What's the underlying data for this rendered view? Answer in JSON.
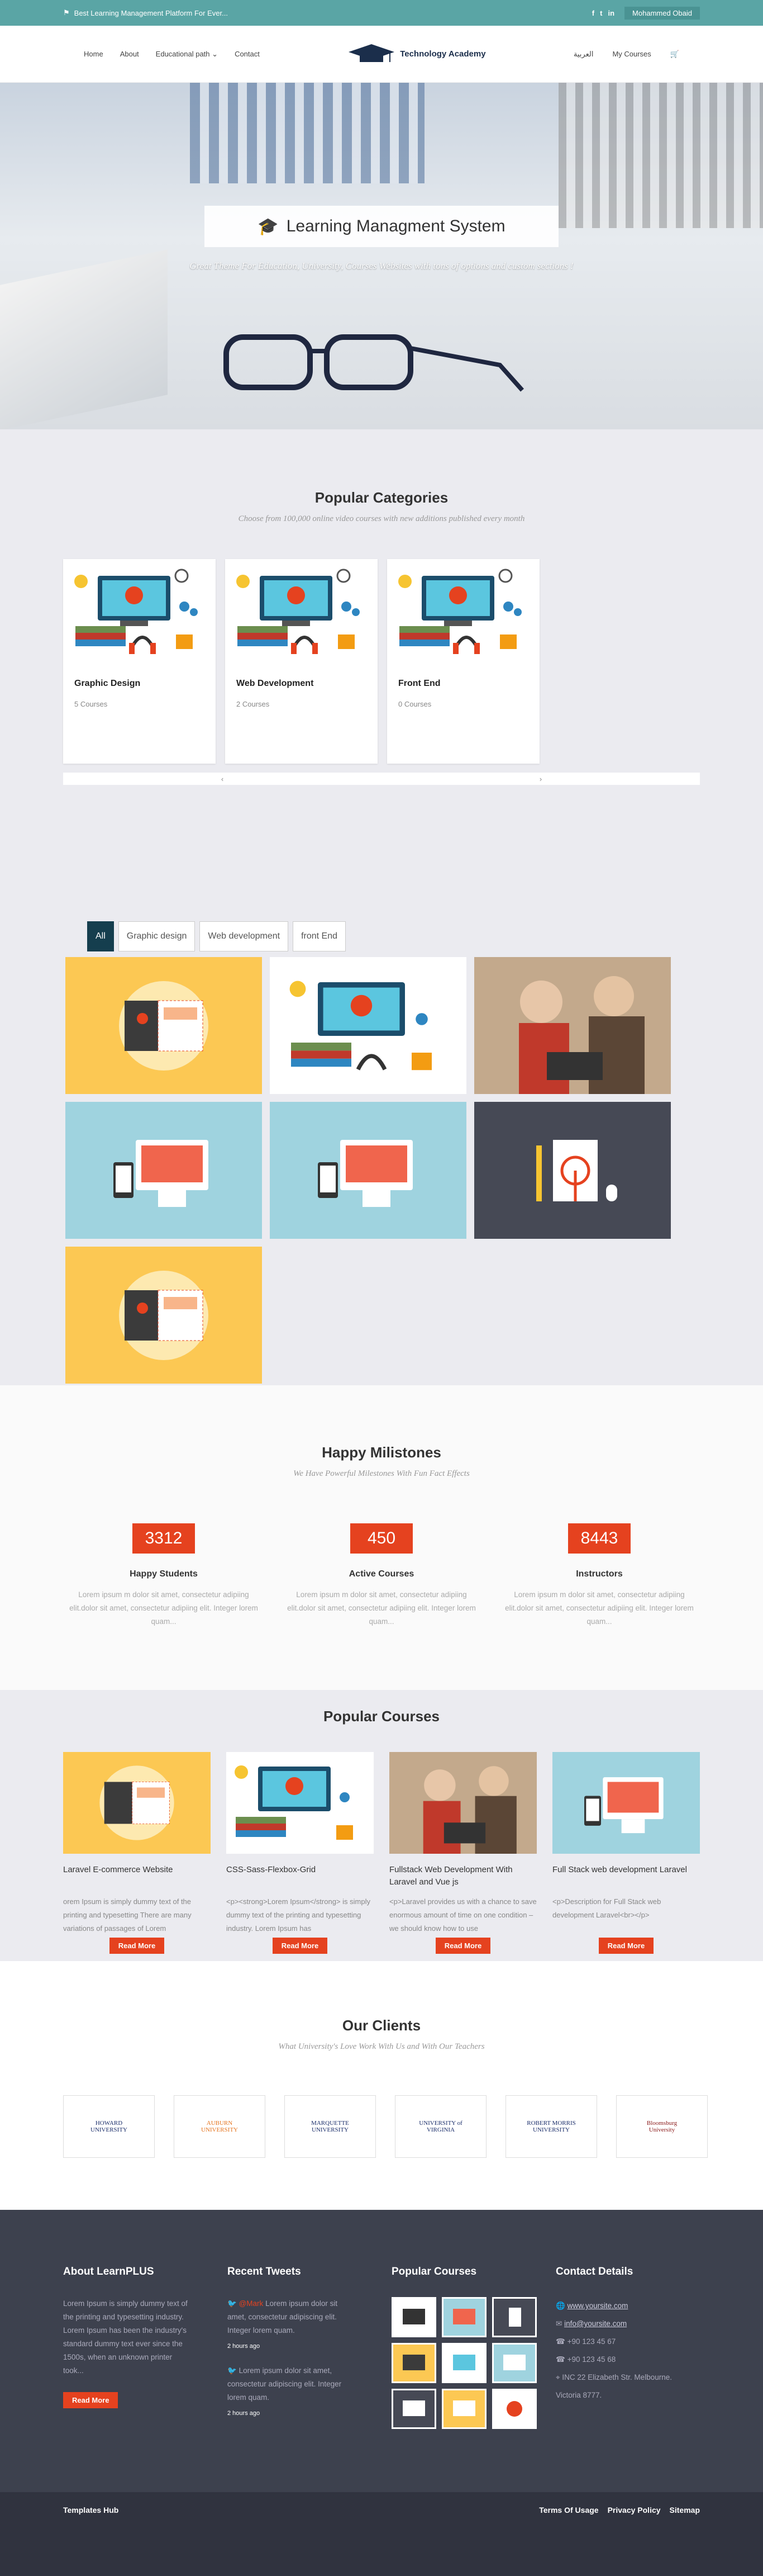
{
  "topbar": {
    "tagline": "Best Learning Management Platform For Ever...",
    "social_icons": [
      "facebook-icon",
      "twitter-icon",
      "linkedin-icon"
    ],
    "user_name": "Mohammed Obaid"
  },
  "nav": {
    "home": "Home",
    "about": "About",
    "educational_path": "Educational path",
    "contact": "Contact",
    "logo_text": "Technology Academy",
    "language": "العربية",
    "my_courses": "My Courses"
  },
  "hero": {
    "title": "Learning Managment System",
    "subtitle": "Great Theme For Education, University, Courses Websites with tons of options and custom sections !"
  },
  "categories": {
    "title": "Popular Categories",
    "subtitle": "Choose from 100,000 online video courses with new additions published every month",
    "items": [
      {
        "name": "Graphic Design",
        "count": "5 Courses"
      },
      {
        "name": "Web Development",
        "count": "2 Courses"
      },
      {
        "name": "Front End",
        "count": "0 Courses"
      }
    ],
    "prev": "‹",
    "next": "›"
  },
  "portfolio": {
    "filters": [
      "All",
      "Graphic design",
      "Web development",
      "front End"
    ]
  },
  "milestones": {
    "title": "Happy Milistones",
    "subtitle": "We Have Powerful Milestones With Fun Fact Effects",
    "items": [
      {
        "value": "3312",
        "label": "Happy Students",
        "desc": "Lorem ipsum m dolor sit amet, consectetur adipiing elit.dolor sit amet, consectetur adipiing elit. Integer lorem quam..."
      },
      {
        "value": "450",
        "label": "Active Courses",
        "desc": "Lorem ipsum m dolor sit amet, consectetur adipiing elit.dolor sit amet, consectetur adipiing elit. Integer lorem quam..."
      },
      {
        "value": "8443",
        "label": "Instructors",
        "desc": "Lorem ipsum m dolor sit amet, consectetur adipiing elit.dolor sit amet, consectetur adipiing elit. Integer lorem quam..."
      }
    ]
  },
  "popular_courses": {
    "title": "Popular Courses",
    "read_more": "Read More",
    "items": [
      {
        "title": "Laravel E-commerce Website",
        "desc": "orem Ipsum is simply dummy text of the printing and typesetting There are many variations of passages of Lorem"
      },
      {
        "title": "CSS-Sass-Flexbox-Grid",
        "desc": "<p><strong>Lorem Ipsum</strong> is simply dummy text of the printing and typesetting industry. Lorem Ipsum has"
      },
      {
        "title": "Fullstack Web Development With Laravel and Vue js",
        "desc": "<p>Laravel provides us with a chance to save enormous amount of time on one condition – we should know how to use"
      },
      {
        "title": "Full Stack web development Laravel",
        "desc": "<p>Description for Full Stack web development Laravel<br></p>"
      }
    ]
  },
  "clients": {
    "title": "Our Clients",
    "subtitle": "What University's Love Work With Us and With Our Teachers",
    "items": [
      "HOWARD UNIVERSITY",
      "AUBURN UNIVERSITY",
      "MARQUETTE UNIVERSITY",
      "UNIVERSITY of VIRGINIA",
      "ROBERT MORRIS UNIVERSITY",
      "Bloomsburg University"
    ]
  },
  "footer": {
    "about_title": "About LearnPLUS",
    "about_text": "Lorem Ipsum is simply dummy text of the printing and typesetting industry. Lorem Ipsum has been the industry's standard dummy text ever since the 1500s, when an unknown printer took...",
    "about_button": "Read More",
    "tweets_title": "Recent Tweets",
    "tweets": [
      {
        "handle": "@Mark",
        "text": "Lorem ipsum dolor sit amet, consectetur adipiscing elit. Integer lorem quam.",
        "time": "2 hours ago"
      },
      {
        "handle": "",
        "text": "Lorem ipsum dolor sit amet, consectetur adipiscing elit. Integer lorem quam.",
        "time": "2 hours ago"
      }
    ],
    "courses_title": "Popular Courses",
    "contact_title": "Contact Details",
    "contact": {
      "website": "www.yoursite.com",
      "email": "info@yoursite.com",
      "phone1": "+90 123 45 67",
      "phone2": "+90 123 45 68",
      "address": "INC 22 Elizabeth Str. Melbourne. Victoria 8777."
    }
  },
  "bottom": {
    "brand": "Templates Hub",
    "terms": "Terms Of Usage",
    "privacy": "Privacy Policy",
    "sitemap": "Sitemap"
  },
  "colors": {
    "accent": "#e5421f",
    "topbar": "#5aa5a5",
    "footer": "#3d414e"
  }
}
